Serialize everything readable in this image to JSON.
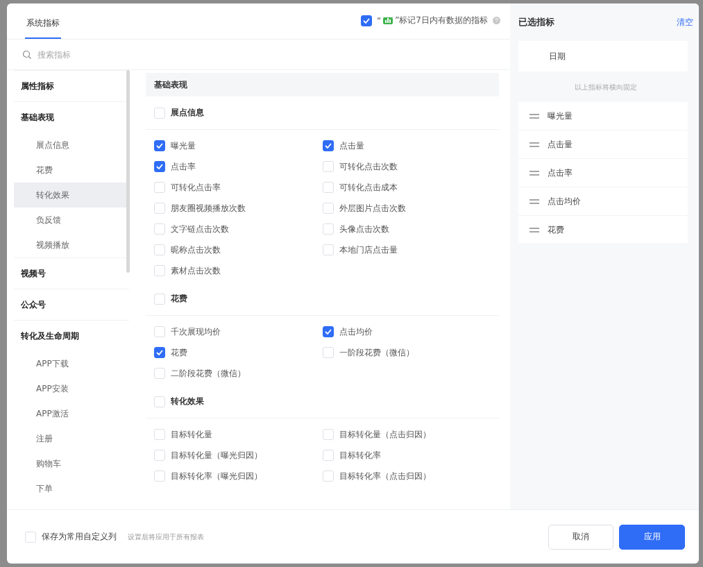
{
  "tabs": [
    {
      "label": "系统指标",
      "selected": true
    }
  ],
  "mark_option": {
    "checked": true,
    "quote_open": "“",
    "label": "”标记7日内有数据的指标"
  },
  "search": {
    "placeholder": "搜索指标"
  },
  "sidebar": [
    {
      "label": "属性指标"
    },
    {
      "label": "基础表现",
      "children": [
        {
          "label": "展点信息",
          "selected": false
        },
        {
          "label": "花费",
          "selected": false
        },
        {
          "label": "转化效果",
          "selected": true
        },
        {
          "label": "负反馈",
          "selected": false
        },
        {
          "label": "视频播放",
          "selected": false
        }
      ]
    },
    {
      "label": "视频号"
    },
    {
      "label": "公众号"
    },
    {
      "label": "转化及生命周期",
      "children": [
        {
          "label": "APP下载",
          "selected": false
        },
        {
          "label": "APP安装",
          "selected": false
        },
        {
          "label": "APP激活",
          "selected": false
        },
        {
          "label": "注册",
          "selected": false
        },
        {
          "label": "购物车",
          "selected": false
        },
        {
          "label": "下单",
          "selected": false
        }
      ]
    }
  ],
  "section_title": "基础表现",
  "groups": [
    {
      "label": "展点信息",
      "checked": false,
      "items": [
        {
          "label": "曝光量",
          "checked": true
        },
        {
          "label": "点击量",
          "checked": true
        },
        {
          "label": "点击率",
          "checked": true
        },
        {
          "label": "可转化点击次数",
          "checked": false
        },
        {
          "label": "可转化点击率",
          "checked": false
        },
        {
          "label": "可转化点击成本",
          "checked": false
        },
        {
          "label": "朋友圈视频播放次数",
          "checked": false
        },
        {
          "label": "外层图片点击次数",
          "checked": false
        },
        {
          "label": "文字链点击次数",
          "checked": false
        },
        {
          "label": "头像点击次数",
          "checked": false
        },
        {
          "label": "昵称点击次数",
          "checked": false
        },
        {
          "label": "本地门店点击量",
          "checked": false
        },
        {
          "label": "素材点击次数",
          "checked": false
        }
      ]
    },
    {
      "label": "花费",
      "checked": false,
      "items": [
        {
          "label": "千次展现均价",
          "checked": false
        },
        {
          "label": "点击均价",
          "checked": true
        },
        {
          "label": "花费",
          "checked": true
        },
        {
          "label": "一阶段花费（微信）",
          "checked": false
        },
        {
          "label": "二阶段花费（微信）",
          "checked": false
        }
      ]
    },
    {
      "label": "转化效果",
      "checked": false,
      "items": [
        {
          "label": "目标转化量",
          "checked": false
        },
        {
          "label": "目标转化量（点击归因）",
          "checked": false
        },
        {
          "label": "目标转化量（曝光归因）",
          "checked": false
        },
        {
          "label": "目标转化率",
          "checked": false
        },
        {
          "label": "目标转化率（曝光归因）",
          "checked": false
        },
        {
          "label": "目标转化率（点击归因）",
          "checked": false
        }
      ]
    }
  ],
  "selected_panel": {
    "title": "已选指标",
    "clear": "清空",
    "fixed": [
      "日期"
    ],
    "fixed_note": "以上指标将横向固定",
    "items": [
      "曝光量",
      "点击量",
      "点击率",
      "点击均价",
      "花费"
    ]
  },
  "footer": {
    "save_option": {
      "label": "保存为常用自定义列",
      "checked": false
    },
    "hint": "设置后将应用于所有报表",
    "cancel": "取消",
    "apply": "应用"
  }
}
